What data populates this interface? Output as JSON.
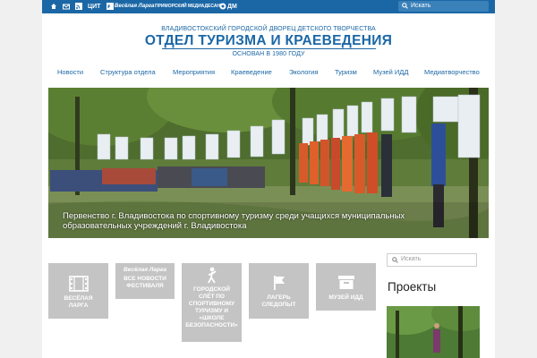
{
  "topbar": {
    "icons": [
      "home-icon",
      "mail-icon",
      "rss-icon",
      "sitemap-icon"
    ],
    "logo_itat": "ЦИТ",
    "logo_vesyolaya": "Весёлая Ларга",
    "mediadesant": "ПРИМОРСКИЙ МЕДИАДЕСАНТ",
    "dm": "ДМ",
    "search_placeholder": "Искать"
  },
  "header": {
    "org": "ВЛАДИВОСТОКСКИЙ ГОРОДСКОЙ ДВОРЕЦ ДЕТСКОГО ТВОРЧЕСТВА",
    "title": "ОТДЕЛ ТУРИЗМА И КРАЕВЕДЕНИЯ",
    "founded": "ОСНОВАН В 1980 ГОДУ"
  },
  "nav": [
    "Новости",
    "Структура отдела",
    "Мероприятия",
    "Краеведение",
    "Экология",
    "Туризм",
    "Музей ИДД",
    "Медиатворчество"
  ],
  "slider": {
    "caption_line1": "Первенство г. Владивостока по спортивному туризму среди учащихся муниципальных",
    "caption_line2": "образовательных учреждений г. Владивостока",
    "slide_count": 6,
    "active_slide": 1
  },
  "tiles": [
    {
      "icon": "film-icon",
      "lines": [
        "ВЕСЁЛАЯ",
        "ЛАРГА"
      ]
    },
    {
      "icon": "vesyolaya-larga-logo",
      "logo": "Весёлая Ларга",
      "lines": [
        "ВСЕ НОВОСТИ",
        "ФЕСТИВАЛЯ"
      ]
    },
    {
      "icon": "climber-icon",
      "lines": [
        "ГОРОДСКОЙ",
        "СЛЁТ ПО",
        "СПОРТИВНОМУ",
        "ТУРИЗМУ И",
        "«ШКОЛЕ",
        "БЕЗОПАСНОСТИ»"
      ]
    },
    {
      "icon": "flag-icon",
      "lines": [
        "ЛАГЕРЬ",
        "СЛЕДОПЫТ"
      ]
    },
    {
      "icon": "archive-icon",
      "lines": [
        "МУЗЕЙ ИДД"
      ]
    }
  ],
  "sidebar": {
    "search_placeholder": "Искать",
    "projects_heading": "Проекты"
  },
  "colors": {
    "brand": "#1b67a6",
    "tile": "#c4c4c4"
  }
}
